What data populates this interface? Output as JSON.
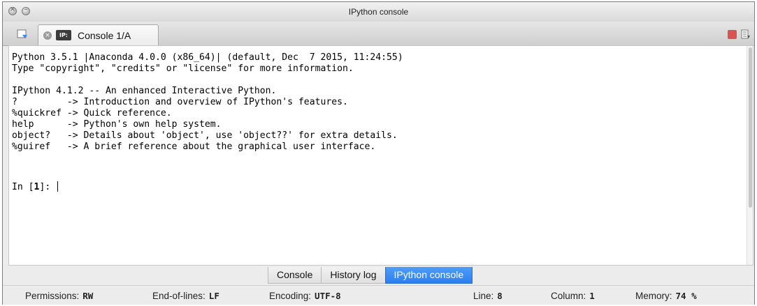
{
  "window": {
    "title": "IPython console"
  },
  "tabs": {
    "console_tab_label": "Console 1/A",
    "console_tab_badge": "IP:"
  },
  "console": {
    "lines": [
      "Python 3.5.1 |Anaconda 4.0.0 (x86_64)| (default, Dec  7 2015, 11:24:55)",
      "Type \"copyright\", \"credits\" or \"license\" for more information.",
      "",
      "IPython 4.1.2 -- An enhanced Interactive Python.",
      "?         -> Introduction and overview of IPython's features.",
      "%quickref -> Quick reference.",
      "help      -> Python's own help system.",
      "object?   -> Details about 'object', use 'object??' for extra details.",
      "%guiref   -> A brief reference about the graphical user interface."
    ],
    "prompt_prefix": "In [",
    "prompt_number": "1",
    "prompt_suffix": "]: "
  },
  "bottom_tabs": {
    "console": "Console",
    "history": "History log",
    "ipython": "IPython console",
    "active": "ipython"
  },
  "statusbar": {
    "permissions_label": "Permissions:",
    "permissions_value": "RW",
    "eol_label": "End-of-lines:",
    "eol_value": "LF",
    "encoding_label": "Encoding:",
    "encoding_value": "UTF-8",
    "line_label": "Line:",
    "line_value": "8",
    "column_label": "Column:",
    "column_value": "1",
    "memory_label": "Memory:",
    "memory_value": "74 %"
  },
  "colors": {
    "active_tab": "#2b7ef0",
    "stop_button": "#d9534f"
  }
}
